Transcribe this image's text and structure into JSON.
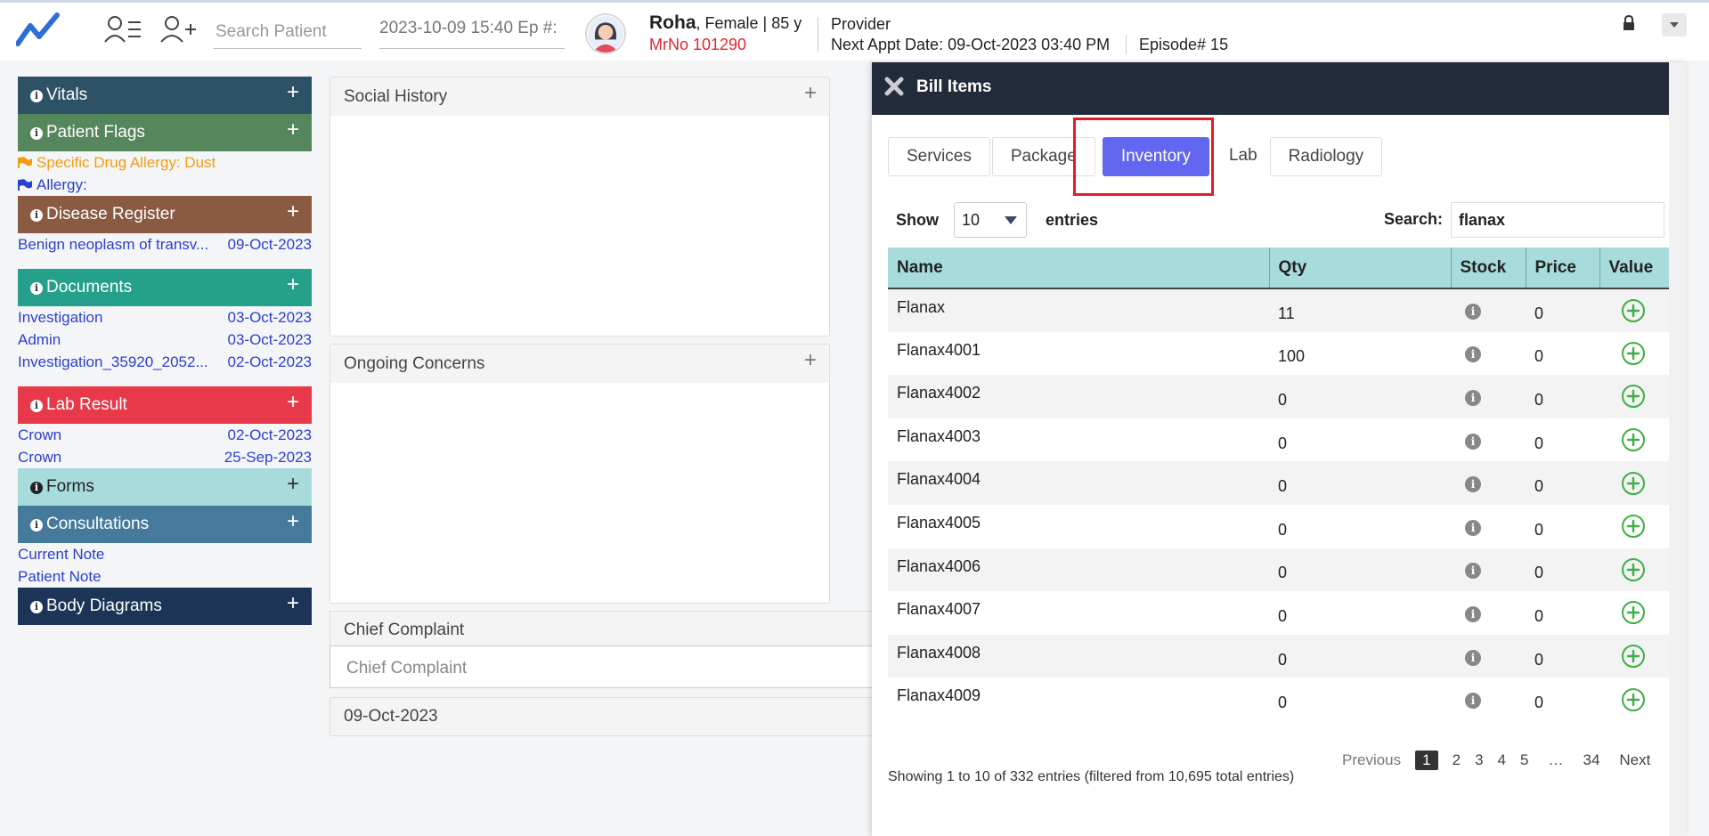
{
  "header": {
    "search_placeholder": "Search Patient",
    "episode_field": "2023-10-09 15:40 Ep #:",
    "patient_name": "Roha",
    "patient_details": ", Female | 85 y",
    "mrno": "MrNo 101290",
    "provider": "Provider",
    "next_appt": "Next Appt Date: 09-Oct-2023 03:40 PM",
    "episode": "Episode# 15"
  },
  "sidebar": {
    "vitals": "Vitals",
    "patient_flags": "Patient Flags",
    "flags": [
      {
        "text": "Specific Drug Allergy: Dust",
        "color": "#f39c12"
      },
      {
        "text": "Allergy:",
        "color": "#2c3fd0"
      }
    ],
    "disease_register": "Disease Register",
    "disease": {
      "name": "Benign neoplasm of transv...",
      "date": "09-Oct-2023"
    },
    "documents": "Documents",
    "document_items": [
      {
        "name": "Investigation",
        "date": "03-Oct-2023"
      },
      {
        "name": "Admin",
        "date": "03-Oct-2023"
      },
      {
        "name": "Investigation_35920_2052...",
        "date": "02-Oct-2023"
      }
    ],
    "lab_result": "Lab Result",
    "lab_items": [
      {
        "name": "Crown",
        "date": "02-Oct-2023"
      },
      {
        "name": "Crown",
        "date": "25-Sep-2023"
      }
    ],
    "forms": "Forms",
    "consultations": "Consultations",
    "consultation_items": [
      "Current Note",
      "Patient Note"
    ],
    "body_diagrams": "Body Diagrams"
  },
  "middle": {
    "social_history": "Social History",
    "ongoing_concerns": "Ongoing Concerns",
    "chief_complaint": "Chief Complaint",
    "chief_complaint_placeholder": "Chief Complaint",
    "date": "09-Oct-2023"
  },
  "bill": {
    "title": "Bill Items",
    "tabs": [
      "Services",
      "Package",
      "Inventory",
      "Lab",
      "Radiology"
    ],
    "active_tab": "Inventory",
    "show_label": "Show",
    "show_value": "10",
    "entries_label": "entries",
    "search_label": "Search:",
    "search_value": "flanax",
    "columns": [
      "Name",
      "Qty",
      "Stock",
      "Price",
      "Value"
    ],
    "rows": [
      {
        "name": "Flanax",
        "qty": "11",
        "price": "0"
      },
      {
        "name": "Flanax4001",
        "qty": "100",
        "price": "0"
      },
      {
        "name": "Flanax4002",
        "qty": "0",
        "price": "0"
      },
      {
        "name": "Flanax4003",
        "qty": "0",
        "price": "0"
      },
      {
        "name": "Flanax4004",
        "qty": "0",
        "price": "0"
      },
      {
        "name": "Flanax4005",
        "qty": "0",
        "price": "0"
      },
      {
        "name": "Flanax4006",
        "qty": "0",
        "price": "0"
      },
      {
        "name": "Flanax4007",
        "qty": "0",
        "price": "0"
      },
      {
        "name": "Flanax4008",
        "qty": "0",
        "price": "0"
      },
      {
        "name": "Flanax4009",
        "qty": "0",
        "price": "0"
      }
    ],
    "showing": "Showing 1 to 10 of 332 entries (filtered from 10,695 total entries)",
    "pager": {
      "previous": "Previous",
      "pages": [
        "1",
        "2",
        "3",
        "4",
        "5",
        "…",
        "34"
      ],
      "current": "1",
      "next": "Next"
    }
  },
  "colors": {
    "vitals": "#2e5265",
    "patient_flags": "#56865c",
    "disease_register": "#8a5a43",
    "documents": "#25a08a",
    "lab_result": "#e8394a",
    "forms": "#a8dcdc",
    "consultations": "#457a9c",
    "body_diagrams": "#1c3557",
    "drawer_header": "#222b3a",
    "active_tab": "#6366f1",
    "table_header": "#a8dcdc",
    "highlight": "#e21c24",
    "add": "#3cb043"
  }
}
